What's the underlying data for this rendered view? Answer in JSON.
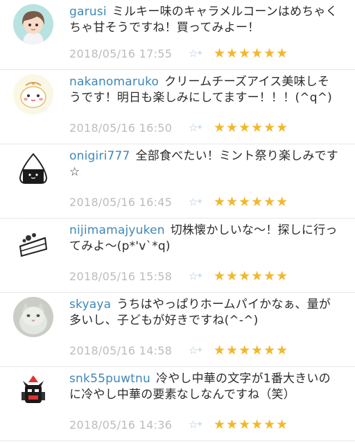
{
  "comments": [
    {
      "username": "garusi",
      "text": "ミルキー味のキャラメルコーンはめちゃくちゃ甘そうですね！買ってみよー！",
      "date": "2018/05/16 17:55",
      "stars": "★★★★★★",
      "avatar_icon": "girl-avatar-icon"
    },
    {
      "username": "nakanomaruko",
      "text": "クリームチーズアイス美味しそうです！明日も楽しみにしてますー！！！(^q^)",
      "date": "2018/05/16 16:50",
      "stars": "★★★★★★",
      "avatar_icon": "maru-character-avatar-icon"
    },
    {
      "username": "onigiri777",
      "text": "全部食べたい！ミント祭り楽しみです☆",
      "date": "2018/05/16 16:45",
      "stars": "★★★★★★",
      "avatar_icon": "onigiri-avatar-icon"
    },
    {
      "username": "nijimamajyuken",
      "text": "切株懐かしいな～！探しに行ってみよ～(p*'v`*q)",
      "date": "2018/05/16 15:58",
      "stars": "★★★★★★",
      "avatar_icon": "cake-slice-avatar-icon"
    },
    {
      "username": "skyaya",
      "text": "うちはやっぱりホームパイかなぁ、量が多いし、子どもが好きですね(^-^)",
      "date": "2018/05/16 14:58",
      "stars": "★★★★★★",
      "avatar_icon": "cat-photo-avatar-icon"
    },
    {
      "username": "snk55puwtnu",
      "text": "冷やし中華の文字が1番大きいのに冷やし中華の要素なしなんですね（笑）",
      "date": "2018/05/16 14:36",
      "stars": "★★★★★★",
      "avatar_icon": "robot-avatar-icon"
    }
  ],
  "colors": {
    "username": "#3f87b8",
    "date": "#bcbcbc",
    "stars": "#f2b82b",
    "fav_icon": "#a9c4dc",
    "divider": "#e6e6e6"
  }
}
